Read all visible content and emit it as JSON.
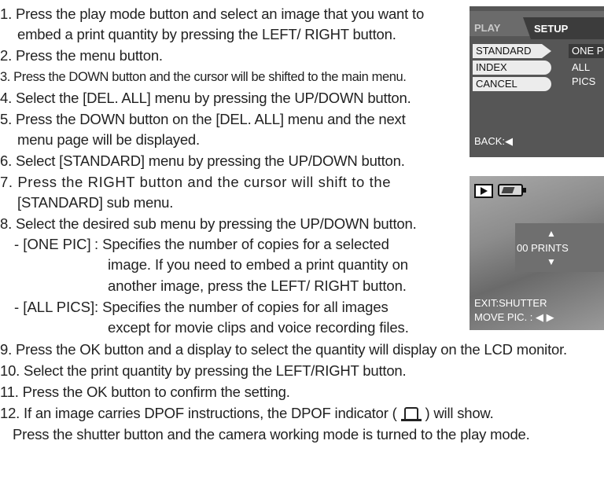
{
  "steps": {
    "s1a": "1. Press the play mode button and select an image that you want to",
    "s1b": "embed a print quantity by pressing the LEFT/ RIGHT button.",
    "s2": "2. Press the menu button.",
    "s3": "3. Press the DOWN button and the cursor will be shifted to the main menu.",
    "s4": "4. Select the [DEL. ALL] menu by pressing the UP/DOWN button.",
    "s5a": "5. Press the DOWN button on the [DEL. ALL] menu and the next",
    "s5b": "menu page will be displayed.",
    "s6": "6. Select [STANDARD] menu by pressing the UP/DOWN button.",
    "s7a": "7. Press the RIGHT button and the cursor will shift to the",
    "s7b": "[STANDARD] sub menu.",
    "s8": "8. Select the desired sub menu by pressing the UP/DOWN button.",
    "one_pic_key": "- [ONE PIC]",
    "one_pic_d1": ": Specifies the number of copies for a selected",
    "one_pic_d2": "image. If you need to embed a print quantity on",
    "one_pic_d3": "another image, press the LEFT/ RIGHT button.",
    "all_pics_key": "- [ALL PICS]",
    "all_pics_d1": ": Specifies the number of copies for all images",
    "all_pics_d2": "except for movie clips and voice recording files.",
    "s9": "9. Press the OK button and a display to select the quantity will display on the LCD monitor.",
    "s10": "10. Select the print quantity by pressing the LEFT/RIGHT button.",
    "s11": "11. Press the OK button to confirm the setting.",
    "s12a": "12. If an image carries DPOF instructions, the DPOF indicator (",
    "s12b": ") will show.",
    "s12c": "Press the shutter button and the camera working mode is turned to the play mode."
  },
  "lcd_menu": {
    "tab_play": "PLAY",
    "tab_setup": "SETUP",
    "items": [
      "STANDARD",
      "INDEX",
      "CANCEL"
    ],
    "sub_items": [
      "ONE PIC",
      "ALL PICS"
    ],
    "back": "BACK:◀"
  },
  "lcd_playback": {
    "up": "▲",
    "prints": "00 PRINTS",
    "down": "▼",
    "exit": "EXIT:SHUTTER",
    "move": "MOVE PIC. : ◀ ▶"
  }
}
